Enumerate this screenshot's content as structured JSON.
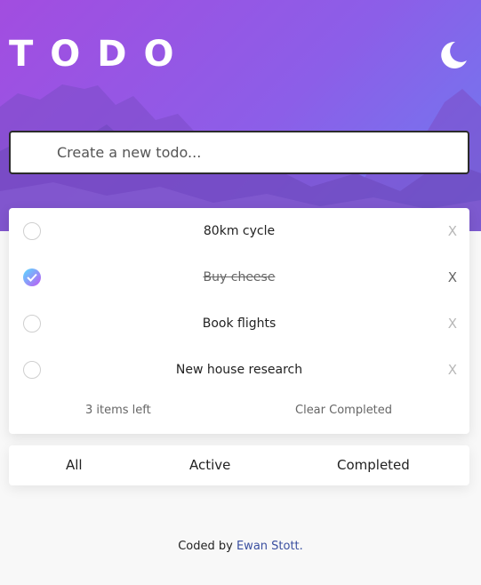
{
  "app": {
    "title": "TODO",
    "theme_icon": "moon-icon"
  },
  "new_todo": {
    "placeholder": "Create a new todo..."
  },
  "todos": [
    {
      "text": "80km cycle",
      "completed": false,
      "delete_label": "X"
    },
    {
      "text": "Buy cheese",
      "completed": true,
      "delete_label": "X"
    },
    {
      "text": "Book flights",
      "completed": false,
      "delete_label": "X"
    },
    {
      "text": "New house research",
      "completed": false,
      "delete_label": "X"
    }
  ],
  "footer": {
    "items_left": "3 items left",
    "clear_completed": "Clear Completed"
  },
  "filters": [
    "All",
    "Active",
    "Completed"
  ],
  "credit": {
    "prefix": "Coded by",
    "author": "Ewan Stott",
    "suffix": "."
  },
  "colors": {
    "hero_gradient_start": "#a24de0",
    "hero_gradient_end": "#6d7cf0",
    "check_gradient_start": "#57ddff",
    "check_gradient_end": "#c058f3",
    "link": "#3a4fa0",
    "background": "#f8f8f8"
  }
}
